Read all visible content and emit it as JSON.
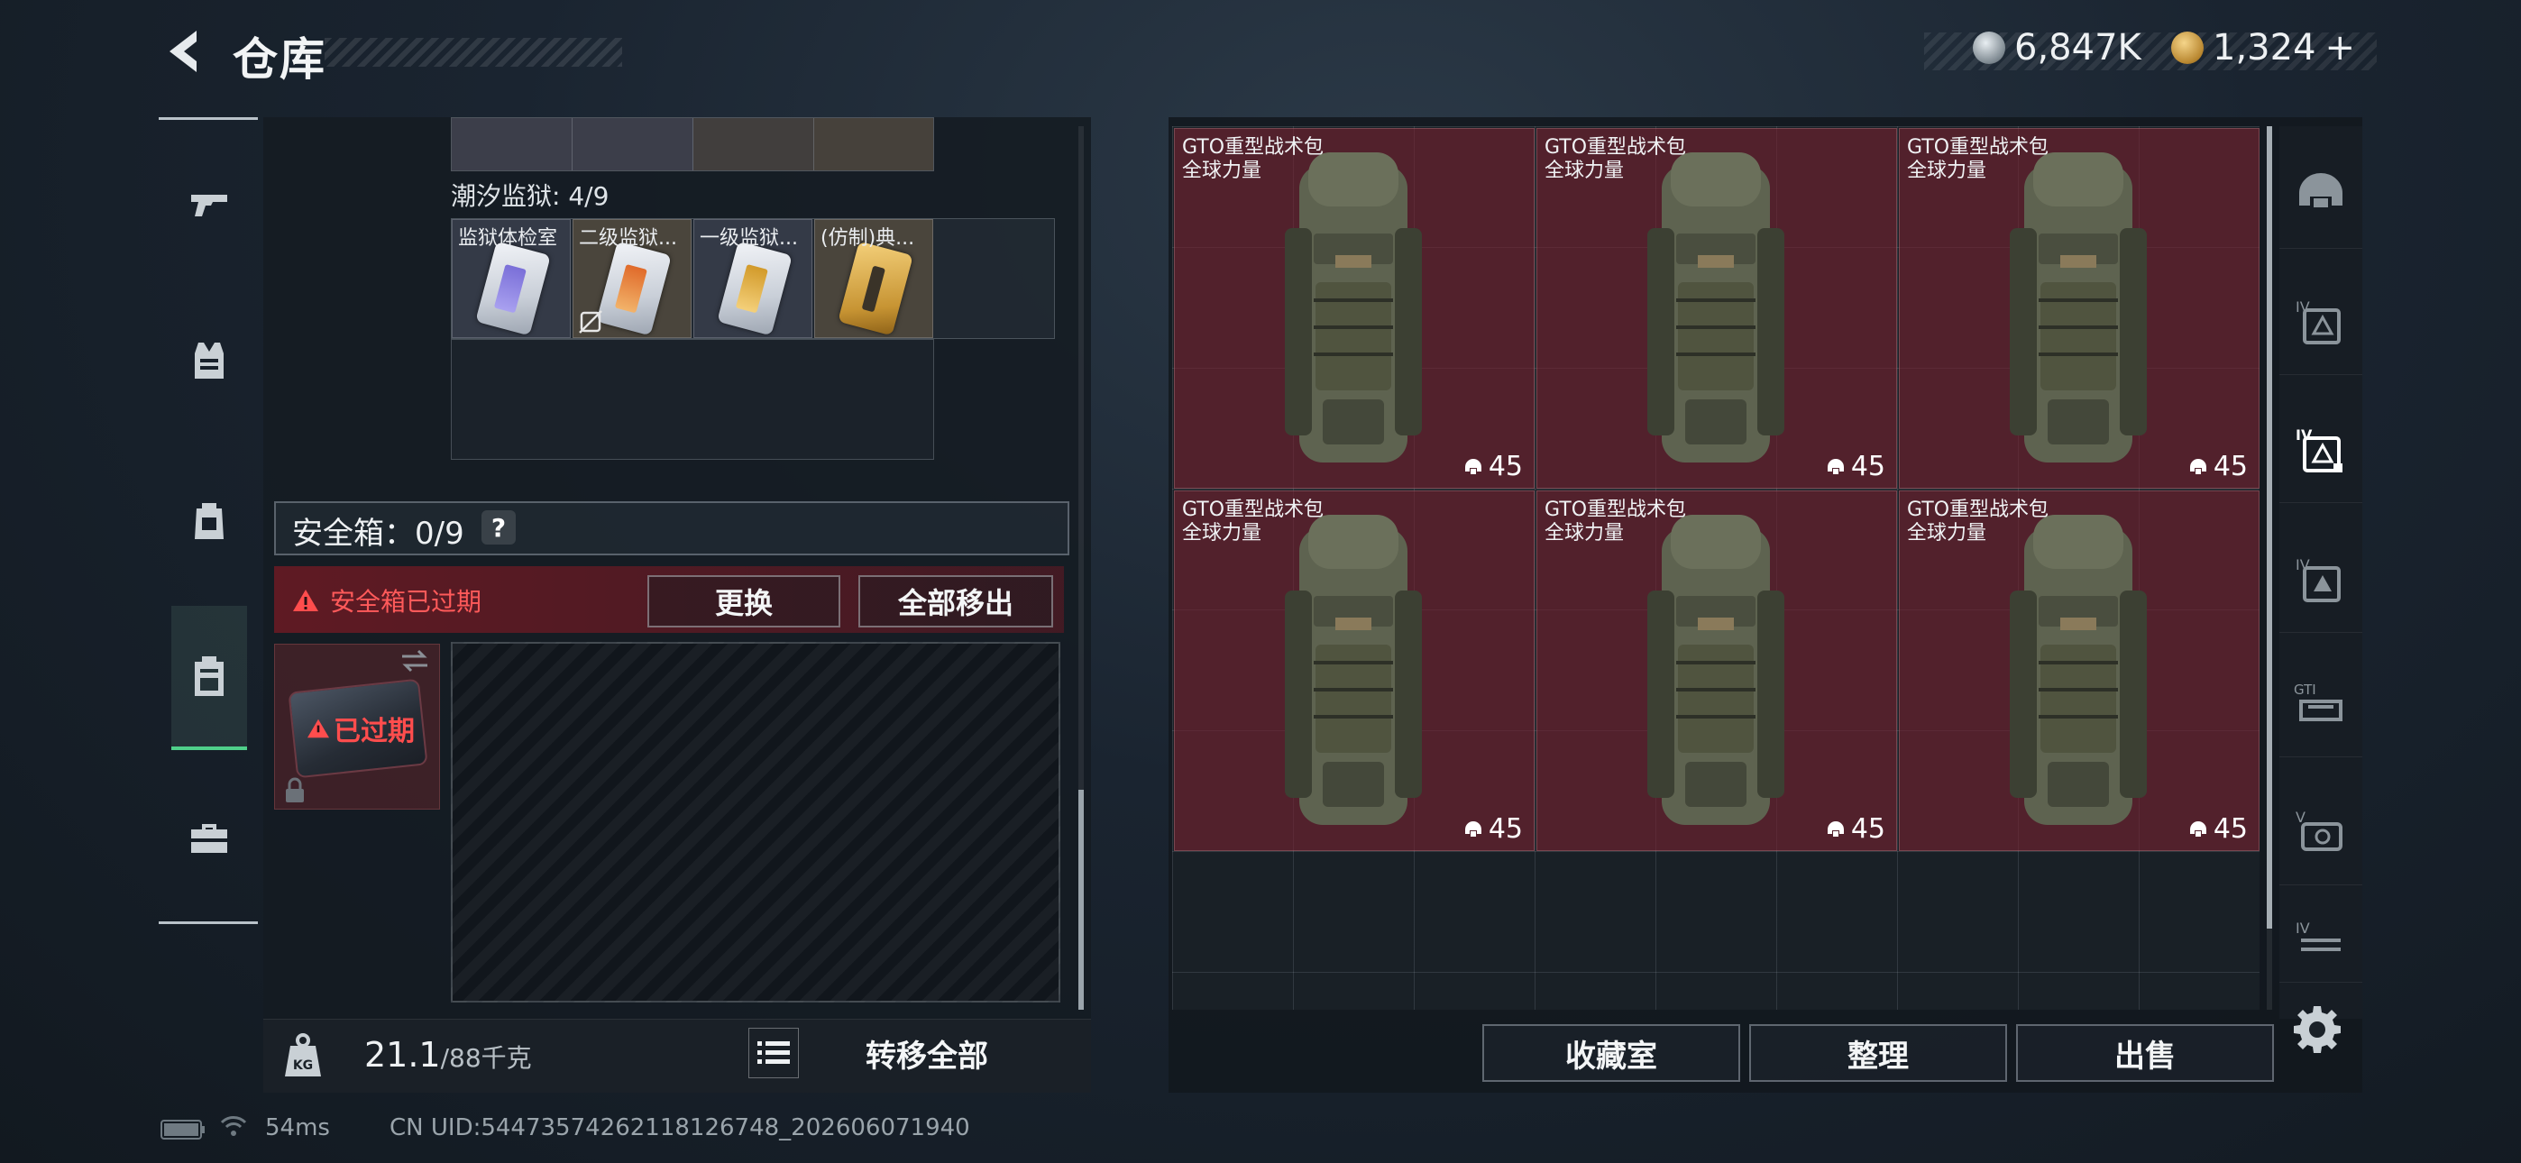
{
  "header": {
    "title": "仓库",
    "currency_silver": "6,847K",
    "currency_gold": "1,324",
    "add_symbol": "+"
  },
  "left_nav": {
    "items": [
      "weapon-icon",
      "vest-icon",
      "backpack-icon",
      "container-icon",
      "toolbox-icon"
    ],
    "active_index": 3
  },
  "left_panel": {
    "tide_prison_label": "潮汐监狱: 4/9",
    "tide_prison_items": [
      {
        "label": "监狱体检室",
        "no_insure": false
      },
      {
        "label": "二级监狱...",
        "no_insure": true
      },
      {
        "label": "一级监狱...",
        "no_insure": false
      },
      {
        "label": "(仿制)典...",
        "no_insure": false
      }
    ],
    "safe_box_title": "安全箱：0/9",
    "help": "?",
    "expired_warning": "安全箱已过期",
    "replace_button": "更换",
    "remove_all_button": "全部移出",
    "safe_expired_label": "已过期",
    "weight_value": "21.1",
    "weight_capacity": "/88千克",
    "transfer_all": "转移全部"
  },
  "right_panel": {
    "items": [
      {
        "name": "GTO重型战术包",
        "sub": "全球力量",
        "count": "45"
      },
      {
        "name": "GTO重型战术包",
        "sub": "全球力量",
        "count": "45"
      },
      {
        "name": "GTO重型战术包",
        "sub": "全球力量",
        "count": "45"
      },
      {
        "name": "GTO重型战术包",
        "sub": "全球力量",
        "count": "45"
      },
      {
        "name": "GTO重型战术包",
        "sub": "全球力量",
        "count": "45"
      },
      {
        "name": "GTO重型战术包",
        "sub": "全球力量",
        "count": "45"
      }
    ],
    "buttons": {
      "collection": "收藏室",
      "organize": "整理",
      "sell": "出售"
    }
  },
  "filters": [
    "helmet-filter-icon",
    "armor-iv-filter-icon",
    "armor-iv-selected-filter-icon",
    "armor-iv-alt-filter-icon",
    "gti-filter-icon",
    "v-filter-icon",
    "iv-bag-filter-icon"
  ],
  "footer": {
    "ping": "54ms",
    "uid": "CN UID:5447357426211812674​8_202606071940"
  },
  "colors": {
    "accent_green": "#4fd08a",
    "expired_red": "#ff5a5a",
    "item_bg": "#76222f"
  }
}
